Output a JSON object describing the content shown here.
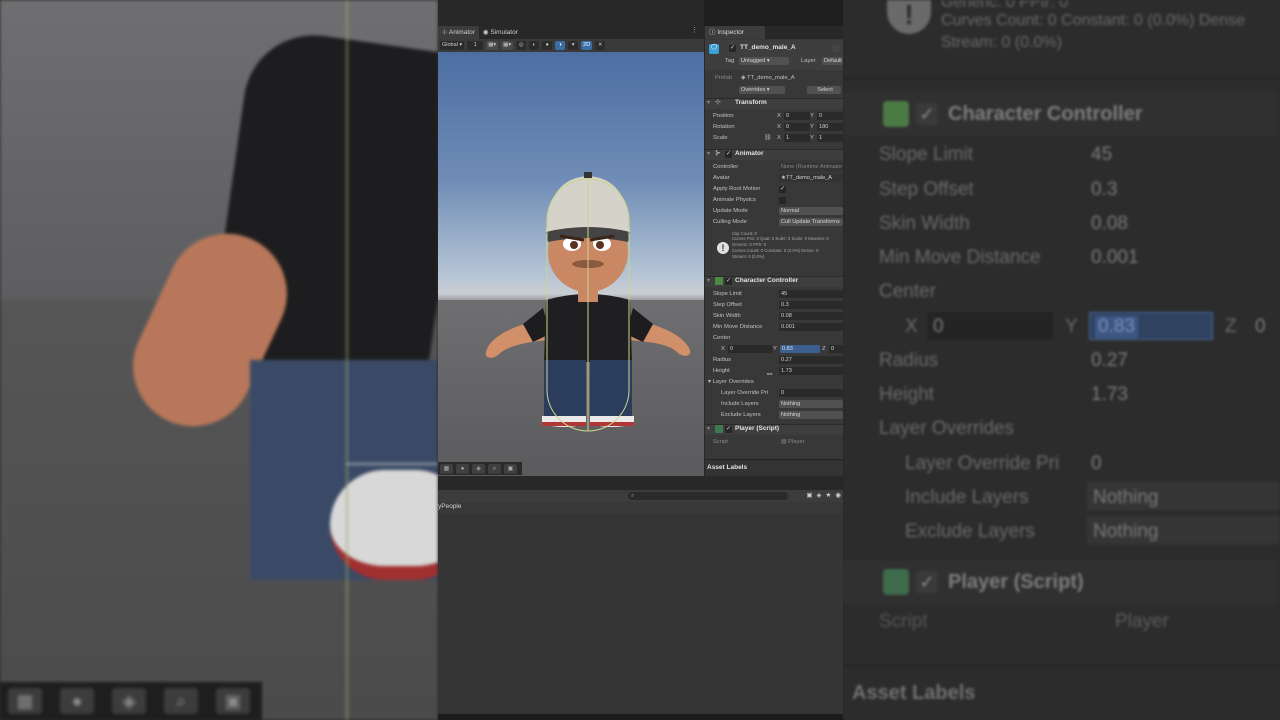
{
  "background_right": {
    "info_line1": "Generic: 0 PPtr: 0",
    "info_line2": "Curves Count: 0 Constant: 0 (0.0%) Dense",
    "info_line3": "Stream: 0 (0.0%)",
    "character_controller": "Character Controller",
    "slope_limit_label": "Slope Limit",
    "slope_limit": "45",
    "step_offset_label": "Step Offset",
    "step_offset": "0.3",
    "skin_width_label": "Skin Width",
    "skin_width": "0.08",
    "min_move_label": "Min Move Distance",
    "min_move": "0.001",
    "center_label": "Center",
    "x_label": "X",
    "x_value": "0",
    "y_label": "Y",
    "y_value": "0.83",
    "z_label": "Z",
    "z_value": "0",
    "radius_label": "Radius",
    "radius": "0.27",
    "height_label": "Height",
    "height": "1.73",
    "layer_overrides_label": "Layer Overrides",
    "layer_override_priority_label": "Layer Override Pri",
    "layer_override_priority": "0",
    "include_layers_label": "Include Layers",
    "include_layers": "Nothing",
    "exclude_layers_label": "Exclude Layers",
    "exclude_layers": "Nothing",
    "player_script": "Player (Script)",
    "script_label": "Script",
    "script_value": "Player",
    "asset_labels": "Asset Labels"
  },
  "scene": {
    "tabs": [
      "Animator",
      "Simulator"
    ],
    "global_dropdown": "Global",
    "number_field": "1",
    "mode_2d": "2D"
  },
  "inspector": {
    "tab_label": "Inspector",
    "object_name": "TT_demo_male_A",
    "tag_label": "Tag",
    "tag_value": "Untagged",
    "layer_label": "Layer",
    "layer_value": "Default",
    "prefab_label": "Prefab",
    "prefab_value": "TT_demo_male_A",
    "overrides_label": "Overrides",
    "select_label": "Select",
    "transform": {
      "title": "Transform",
      "position_label": "Position",
      "pos_x": "0",
      "pos_y": "0",
      "rotation_label": "Rotation",
      "rot_x": "0",
      "rot_y": "180",
      "scale_label": "Scale",
      "scale_x": "1",
      "scale_y": "1"
    },
    "animator": {
      "title": "Animator",
      "controller_label": "Controller",
      "controller_value": "None (Runtime Animator Controller)",
      "avatar_label": "Avatar",
      "avatar_value": "TT_demo_male_A",
      "apply_root_label": "Apply Root Motion",
      "animate_physics_label": "Animate Physics",
      "update_mode_label": "Update Mode",
      "update_mode_value": "Normal",
      "culling_mode_label": "Culling Mode",
      "culling_mode_value": "Cull Update Transforms",
      "info_lines": [
        "Clip Count: 0",
        "Curves Pos: 0 Quat: 0 Euler: 0 Scale: 0 Muscles: 0",
        "Generic: 0 PPtr: 0",
        "Curves Count: 0 Constant: 0 (0.0%) Dense: 0",
        "Stream: 0 (0.0%)"
      ]
    },
    "character_controller": {
      "title": "Character Controller",
      "slope_limit_label": "Slope Limit",
      "slope_limit": "45",
      "step_offset_label": "Step Offset",
      "step_offset": "0.3",
      "skin_width_label": "Skin Width",
      "skin_width": "0.08",
      "min_move_label": "Min Move Distance",
      "min_move": "0.001",
      "center_label": "Center",
      "x_label": "X",
      "center_x": "0",
      "y_label": "Y",
      "center_y": "0.83",
      "z_label": "Z",
      "center_z": "0",
      "radius_label": "Radius",
      "radius": "0.27",
      "height_label": "Height",
      "height": "1.73",
      "layer_overrides_label": "Layer Overrides",
      "layer_override_priority_label": "Layer Override Pri",
      "layer_override_priority": "0",
      "include_layers_label": "Include Layers",
      "include_layers": "Nothing",
      "exclude_layers_label": "Exclude Layers",
      "exclude_layers": "Nothing"
    },
    "player_script": {
      "title": "Player (Script)",
      "script_label": "Script",
      "script_value": "Player"
    },
    "asset_labels": "Asset Labels"
  },
  "project": {
    "breadcrumb": "yPeople"
  },
  "colors": {
    "accent_blue": "#3b6ea5",
    "capsule_outline": "#c8d68a",
    "selection": "#3d5f8e"
  }
}
